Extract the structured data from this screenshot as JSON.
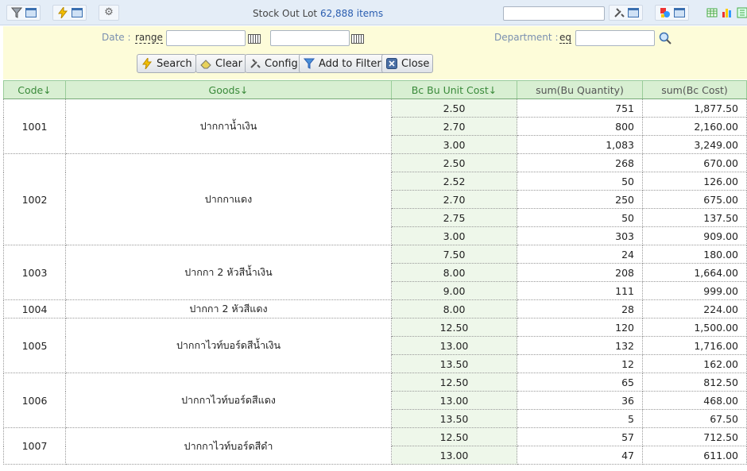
{
  "header": {
    "title": "Stock Out Lot",
    "count": "62,888 items"
  },
  "filter": {
    "date_label": "Date",
    "date_op": "range",
    "date_from": "",
    "date_to": "",
    "department_label": "Department",
    "department_op": "eq",
    "department_value": ""
  },
  "actions": {
    "search": "Search",
    "clear": "Clear",
    "config": "Config",
    "add_to_filter": "Add to Filter",
    "close": "Close"
  },
  "columns": [
    "Code↓",
    "Goods↓",
    "Bc Bu Unit Cost↓",
    "sum(Bu Quantity)",
    "sum(Bc Cost)"
  ],
  "groups": [
    {
      "code": "1001",
      "goods": "ปากกาน้ำเงิน",
      "rows": [
        [
          "2.50",
          "751",
          "1,877.50"
        ],
        [
          "2.70",
          "800",
          "2,160.00"
        ],
        [
          "3.00",
          "1,083",
          "3,249.00"
        ]
      ]
    },
    {
      "code": "1002",
      "goods": "ปากกาแดง",
      "rows": [
        [
          "2.50",
          "268",
          "670.00"
        ],
        [
          "2.52",
          "50",
          "126.00"
        ],
        [
          "2.70",
          "250",
          "675.00"
        ],
        [
          "2.75",
          "50",
          "137.50"
        ],
        [
          "3.00",
          "303",
          "909.00"
        ]
      ]
    },
    {
      "code": "1003",
      "goods": "ปากกา 2 หัวสีน้ำเงิน",
      "rows": [
        [
          "7.50",
          "24",
          "180.00"
        ],
        [
          "8.00",
          "208",
          "1,664.00"
        ],
        [
          "9.00",
          "111",
          "999.00"
        ]
      ]
    },
    {
      "code": "1004",
      "goods": "ปากกา 2 หัวสีแดง",
      "rows": [
        [
          "8.00",
          "28",
          "224.00"
        ]
      ]
    },
    {
      "code": "1005",
      "goods": "ปากกาไวท์บอร์ดสีน้ำเงิน",
      "rows": [
        [
          "12.50",
          "120",
          "1,500.00"
        ],
        [
          "13.00",
          "132",
          "1,716.00"
        ],
        [
          "13.50",
          "12",
          "162.00"
        ]
      ]
    },
    {
      "code": "1006",
      "goods": "ปากกาไวท์บอร์ดสีแดง",
      "rows": [
        [
          "12.50",
          "65",
          "812.50"
        ],
        [
          "13.00",
          "36",
          "468.00"
        ],
        [
          "13.50",
          "5",
          "67.50"
        ]
      ]
    },
    {
      "code": "1007",
      "goods": "ปากกาไวท์บอร์ดสีดำ",
      "rows": [
        [
          "12.50",
          "57",
          "712.50"
        ],
        [
          "13.00",
          "47",
          "611.00"
        ]
      ]
    }
  ]
}
